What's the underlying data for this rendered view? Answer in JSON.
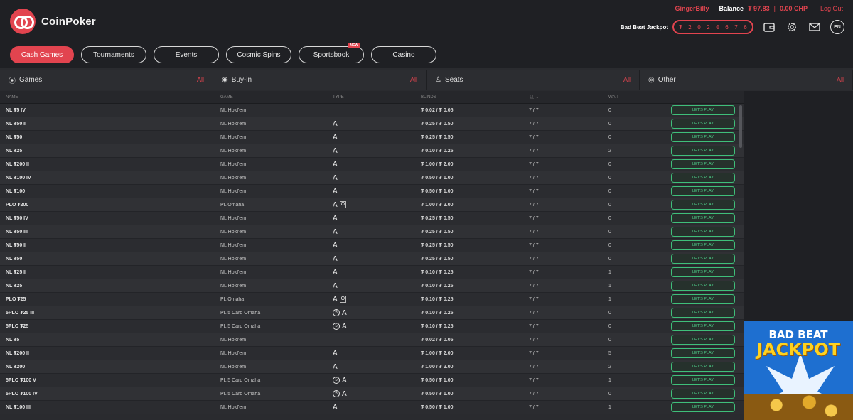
{
  "brand": {
    "name": "CoinPoker"
  },
  "account": {
    "username": "GingerBilly",
    "balance_label": "Balance",
    "balance_value": "₮ 97.83",
    "separator": "|",
    "chp_value": "0.00 CHP",
    "logout_label": "Log Out"
  },
  "jackpot": {
    "label": "Bad Beat Jackpot",
    "digits": [
      "₮",
      "2",
      "0",
      "2",
      "0",
      "6",
      "7",
      "6"
    ]
  },
  "header_icons": {
    "wallet": "wallet-icon",
    "settings": "gear-icon",
    "mail": "mail-icon",
    "language": "EN"
  },
  "nav": [
    {
      "label": "Cash Games",
      "active": true
    },
    {
      "label": "Tournaments"
    },
    {
      "label": "Events"
    },
    {
      "label": "Cosmic Spins"
    },
    {
      "label": "Sportsbook",
      "badge": "NEW"
    },
    {
      "label": "Casino"
    }
  ],
  "filters": [
    {
      "label": "Games",
      "value": "All",
      "icon": "games-icon"
    },
    {
      "label": "Buy-in",
      "value": "All",
      "icon": "buyin-icon"
    },
    {
      "label": "Seats",
      "value": "All",
      "icon": "seats-icon"
    },
    {
      "label": "Other",
      "value": "All",
      "icon": "eye-icon"
    }
  ],
  "table": {
    "headers": {
      "name": "NAME",
      "game": "GAME",
      "type": "TYPE",
      "stakes": "BLINDS",
      "wait": "WAIT"
    },
    "play_label": "LET'S PLAY",
    "rows": [
      {
        "name": "NL ₮5 IV",
        "game": "NL Hold'em",
        "type": [],
        "stakes": "₮ 0.02 / ₮ 0.05",
        "seats": "7 / 7",
        "wait": "0"
      },
      {
        "name": "NL ₮50 II",
        "game": "NL Hold'em",
        "type": [
          "A"
        ],
        "stakes": "₮ 0.25 / ₮ 0.50",
        "seats": "7 / 7",
        "wait": "0"
      },
      {
        "name": "NL ₮50",
        "game": "NL Hold'em",
        "type": [
          "A"
        ],
        "stakes": "₮ 0.25 / ₮ 0.50",
        "seats": "7 / 7",
        "wait": "0"
      },
      {
        "name": "NL ₮25",
        "game": "NL Hold'em",
        "type": [
          "A"
        ],
        "stakes": "₮ 0.10 / ₮ 0.25",
        "seats": "7 / 7",
        "wait": "2"
      },
      {
        "name": "NL ₮200 II",
        "game": "NL Hold'em",
        "type": [
          "A"
        ],
        "stakes": "₮ 1.00 / ₮ 2.00",
        "seats": "7 / 7",
        "wait": "0"
      },
      {
        "name": "NL ₮100 IV",
        "game": "NL Hold'em",
        "type": [
          "A"
        ],
        "stakes": "₮ 0.50 / ₮ 1.00",
        "seats": "7 / 7",
        "wait": "0"
      },
      {
        "name": "NL ₮100",
        "game": "NL Hold'em",
        "type": [
          "A"
        ],
        "stakes": "₮ 0.50 / ₮ 1.00",
        "seats": "7 / 7",
        "wait": "0"
      },
      {
        "name": "PLO ₮200",
        "game": "PL Omaha",
        "type": [
          "A",
          "O"
        ],
        "stakes": "₮ 1.00 / ₮ 2.00",
        "seats": "7 / 7",
        "wait": "0"
      },
      {
        "name": "NL ₮50 IV",
        "game": "NL Hold'em",
        "type": [
          "A"
        ],
        "stakes": "₮ 0.25 / ₮ 0.50",
        "seats": "7 / 7",
        "wait": "0"
      },
      {
        "name": "NL ₮50 III",
        "game": "NL Hold'em",
        "type": [
          "A"
        ],
        "stakes": "₮ 0.25 / ₮ 0.50",
        "seats": "7 / 7",
        "wait": "0"
      },
      {
        "name": "NL ₮50 II",
        "game": "NL Hold'em",
        "type": [
          "A"
        ],
        "stakes": "₮ 0.25 / ₮ 0.50",
        "seats": "7 / 7",
        "wait": "0"
      },
      {
        "name": "NL ₮50",
        "game": "NL Hold'em",
        "type": [
          "A"
        ],
        "stakes": "₮ 0.25 / ₮ 0.50",
        "seats": "7 / 7",
        "wait": "0"
      },
      {
        "name": "NL ₮25 II",
        "game": "NL Hold'em",
        "type": [
          "A"
        ],
        "stakes": "₮ 0.10 / ₮ 0.25",
        "seats": "7 / 7",
        "wait": "1"
      },
      {
        "name": "NL ₮25",
        "game": "NL Hold'em",
        "type": [
          "A"
        ],
        "stakes": "₮ 0.10 / ₮ 0.25",
        "seats": "7 / 7",
        "wait": "1"
      },
      {
        "name": "PLO ₮25",
        "game": "PL Omaha",
        "type": [
          "A",
          "O"
        ],
        "stakes": "₮ 0.10 / ₮ 0.25",
        "seats": "7 / 7",
        "wait": "1"
      },
      {
        "name": "5PLO ₮25 III",
        "game": "PL 5 Card Omaha",
        "type": [
          "5",
          "A"
        ],
        "stakes": "₮ 0.10 / ₮ 0.25",
        "seats": "7 / 7",
        "wait": "0"
      },
      {
        "name": "5PLO ₮25",
        "game": "PL 5 Card Omaha",
        "type": [
          "5",
          "A"
        ],
        "stakes": "₮ 0.10 / ₮ 0.25",
        "seats": "7 / 7",
        "wait": "0"
      },
      {
        "name": "NL ₮5",
        "game": "NL Hold'em",
        "type": [],
        "stakes": "₮ 0.02 / ₮ 0.05",
        "seats": "7 / 7",
        "wait": "0"
      },
      {
        "name": "NL ₮200 II",
        "game": "NL Hold'em",
        "type": [
          "A"
        ],
        "stakes": "₮ 1.00 / ₮ 2.00",
        "seats": "7 / 7",
        "wait": "5"
      },
      {
        "name": "NL ₮200",
        "game": "NL Hold'em",
        "type": [
          "A"
        ],
        "stakes": "₮ 1.00 / ₮ 2.00",
        "seats": "7 / 7",
        "wait": "2"
      },
      {
        "name": "5PLO ₮100 V",
        "game": "PL 5 Card Omaha",
        "type": [
          "5",
          "A"
        ],
        "stakes": "₮ 0.50 / ₮ 1.00",
        "seats": "7 / 7",
        "wait": "1"
      },
      {
        "name": "5PLO ₮100 IV",
        "game": "PL 5 Card Omaha",
        "type": [
          "5",
          "A"
        ],
        "stakes": "₮ 0.50 / ₮ 1.00",
        "seats": "7 / 7",
        "wait": "0"
      },
      {
        "name": "NL ₮100 III",
        "game": "NL Hold'em",
        "type": [
          "A"
        ],
        "stakes": "₮ 0.50 / ₮ 1.00",
        "seats": "7 / 7",
        "wait": "1"
      }
    ]
  },
  "banner": {
    "line1": "BAD BEAT",
    "line2": "JACKPOT"
  },
  "colors": {
    "accent": "#e2444f",
    "play_green": "#4ed08a",
    "background": "#2a2b2f",
    "header": "#1f2024"
  }
}
